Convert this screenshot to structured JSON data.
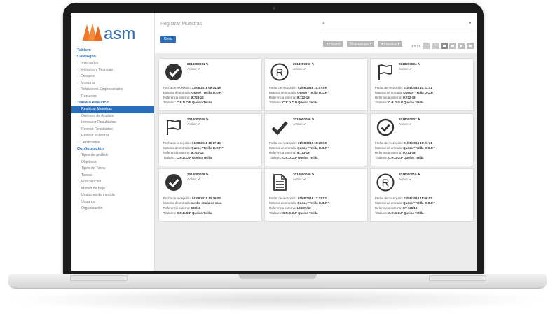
{
  "app": {
    "brand": "asm",
    "page_title": "Registrar Muestras"
  },
  "sidebar": {
    "sections": [
      {
        "title": "Tablero",
        "items": []
      },
      {
        "title": "Catálogos",
        "items": [
          {
            "label": "Inventarios",
            "arrow": true
          },
          {
            "label": "Métodos y Técnicas",
            "arrow": true
          },
          {
            "label": "Ensayos",
            "arrow": true
          },
          {
            "label": "Muestras",
            "arrow": true
          },
          {
            "label": "Relaciones Empresariales",
            "arrow": true
          },
          {
            "label": "Recursos",
            "arrow": false
          }
        ]
      },
      {
        "title": "Trabajo Analítico",
        "items": [
          {
            "label": "Registrar Muestras",
            "arrow": false,
            "active": true
          },
          {
            "label": "Órdenes de Análisis",
            "arrow": false
          },
          {
            "label": "Introducir Resultados",
            "arrow": false
          },
          {
            "label": "Revisar Resultados",
            "arrow": false
          },
          {
            "label": "Revisar Muestras",
            "arrow": false
          },
          {
            "label": "Certificados",
            "arrow": true
          }
        ]
      },
      {
        "title": "Configuración",
        "items": [
          {
            "label": "Tipos de análisis"
          },
          {
            "label": "Objetivos"
          },
          {
            "label": "Tipos de Tarea"
          },
          {
            "label": "Tareas"
          },
          {
            "label": "Frecuencias"
          },
          {
            "label": "Motivo de baja"
          },
          {
            "label": "Unidades de medida"
          },
          {
            "label": "Usuarios"
          },
          {
            "label": "Organización"
          }
        ]
      }
    ]
  },
  "toolbar": {
    "create_label": "Crear",
    "search_icon": "magnifier",
    "filters_label": "▼Filtros ▾",
    "group_label": "☰Agrupar por ▾",
    "favorites_label": "★Favoritos ▾",
    "pager_text": "1-9 / 9",
    "prev": "‹",
    "next": "›"
  },
  "card_labels": {
    "date": "Fecha de recepción:",
    "material": "Material de entrada:",
    "reference": "Referencia externa:",
    "holder": "Titulares:"
  },
  "cards": [
    {
      "code": "2018000001",
      "status": "Activo: ✔",
      "icon": "check-circle-icon",
      "date": "23/09/2018 09:24:49",
      "material": "Queso \"Tetilla D.O.P.\"",
      "ref": "IK724-18",
      "holder": "C.R.D.O.P Queixo Tetilla"
    },
    {
      "code": "2018000002",
      "status": "Activo: ✔",
      "icon": "registered-icon",
      "date": "01/08/2018 10:07:09",
      "material": "Queso \"Tetilla D.O.P.\"",
      "ref": "IK722-18",
      "holder": "C.R.D.O.P Queixo Tetilla"
    },
    {
      "code": "2018000004",
      "status": "Activo: ✔",
      "icon": "flag-icon",
      "date": "01/08/2018 10:11:41",
      "material": "Queso \"Tetilla D.O.P.\"",
      "ref": "IK722-18",
      "holder": "C.R.D.O.P Queixo Tetilla"
    },
    {
      "code": "2018000005",
      "status": "Activo: ✔",
      "icon": "flag-icon",
      "date": "01/08/2018 10:17:46",
      "material": "Queso \"Tetilla D.O.P.\"",
      "ref": "IK722-18",
      "holder": "C.R.D.O.P Queixo Tetilla"
    },
    {
      "code": "2018000006",
      "status": "Activo: ✔",
      "icon": "checkmark-icon",
      "date": "01/08/2018 10:20:03",
      "material": "Queso \"Tetilla D.O.P.\"",
      "ref": "IK723-18",
      "holder": "C.R.D.O.P Queixo Tetilla"
    },
    {
      "code": "2018000007",
      "status": "Activo: ✔",
      "icon": "check-circle-outline-icon",
      "date": "01/08/2018 10:26:31",
      "material": "Queso \"Tetilla D.O.P.\"",
      "ref": "IK723-18",
      "holder": "C.R.D.O.P Queixo Tetilla"
    },
    {
      "code": "2018000008",
      "status": "Activo: ✔",
      "icon": "check-circle-icon",
      "date": "01/08/2018 10:29:03",
      "material": "Leche cruda de vaca",
      "ref": "528/18",
      "holder": "C.R.D.O.P Queixo Tetilla"
    },
    {
      "code": "2018000009",
      "status": "Activo: ✔",
      "icon": "document-icon",
      "date": "01/08/2018 12:22:03",
      "material": "Queso \"Tetilla D.O.P.\"",
      "ref": "L24CR/18",
      "holder": "C.R.D.O.P Queixo Tetilla"
    },
    {
      "code": "2018000010",
      "status": "Activo: ✔",
      "icon": "registered-icon",
      "date": "02/08/2018 11:06:02",
      "material": "Queso \"Tetilla D.O.P.\"",
      "ref": "GT-125/18",
      "holder": "C.R.D.O.P Queixo Tetilla"
    }
  ],
  "colors": {
    "accent": "#2a6ebb",
    "logo_orange": "#f07a2a",
    "logo_blue": "#2f6db5"
  }
}
